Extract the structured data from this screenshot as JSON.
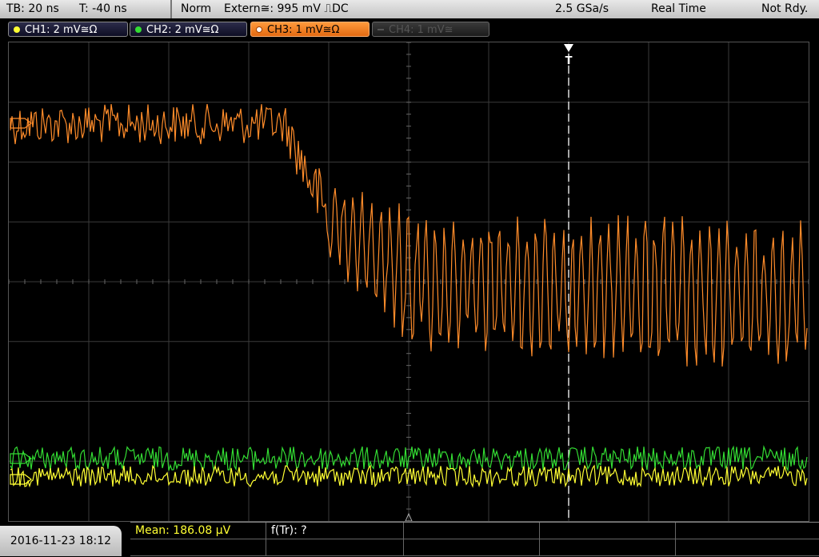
{
  "topbar": {
    "timebase": "TB: 20 ns",
    "trigger_pos": "T: -40 ns",
    "mode": "Norm",
    "trigger_source": "Extern≅: 995 mV ⎍DC",
    "sample_rate": "2.5 GSa/s",
    "acq_mode": "Real Time",
    "status": "Not Rdy."
  },
  "channels": [
    {
      "label": "CH1: 2 mV≅Ω",
      "color": "#ffff33",
      "active": true
    },
    {
      "label": "CH2: 2 mV≅Ω",
      "color": "#33dd33",
      "active": true
    },
    {
      "label": "CH3: 1 mV≅Ω",
      "color": "#ff8c2a",
      "active": true,
      "selected": true
    },
    {
      "label": "CH4: 1 mV≅",
      "color": "#666666",
      "active": false
    }
  ],
  "trigger_marker": "T",
  "bottom": {
    "datetime": "2016-11-23 18:12",
    "measurement_1": "Mean: 186.08 µV",
    "measurement_2": "f(Tr): ?"
  },
  "colors": {
    "grid": "#3a3a3a",
    "ch1": "#ffff33",
    "ch2": "#33dd33",
    "ch3": "#ff8c2a",
    "trigger_line": "#ffffff"
  }
}
